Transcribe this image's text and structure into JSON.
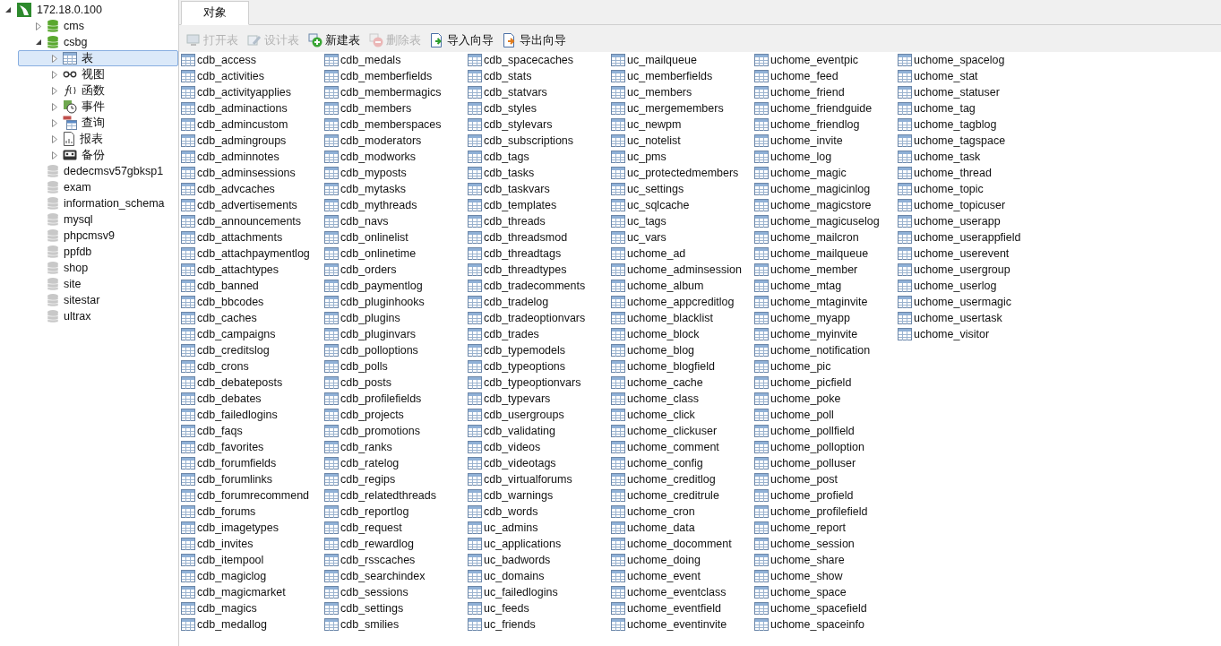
{
  "tree": [
    {
      "kind": "server",
      "label": "172.18.0.100",
      "expanded": true,
      "children": [
        {
          "kind": "database",
          "label": "cms",
          "open": true,
          "expanded": false,
          "selected": false
        },
        {
          "kind": "database",
          "label": "csbg",
          "open": true,
          "expanded": true,
          "selected": false,
          "children": [
            {
              "kind": "tables",
              "label": "表",
              "expanded": false,
              "selected": true
            },
            {
              "kind": "views",
              "label": "视图",
              "expanded": false,
              "selected": false
            },
            {
              "kind": "functions",
              "label": "函数",
              "expanded": false,
              "selected": false
            },
            {
              "kind": "events",
              "label": "事件",
              "expanded": false,
              "selected": false
            },
            {
              "kind": "queries",
              "label": "查询",
              "expanded": false,
              "selected": false
            },
            {
              "kind": "reports",
              "label": "报表",
              "expanded": false,
              "selected": false
            },
            {
              "kind": "backups",
              "label": "备份",
              "expanded": false,
              "selected": false
            }
          ]
        },
        {
          "kind": "database",
          "label": "dedecmsv57gbksp1",
          "open": false,
          "selected": false
        },
        {
          "kind": "database",
          "label": "exam",
          "open": false,
          "selected": false
        },
        {
          "kind": "database",
          "label": "information_schema",
          "open": false,
          "selected": false
        },
        {
          "kind": "database",
          "label": "mysql",
          "open": false,
          "selected": false
        },
        {
          "kind": "database",
          "label": "phpcmsv9",
          "open": false,
          "selected": false
        },
        {
          "kind": "database",
          "label": "ppfdb",
          "open": false,
          "selected": false
        },
        {
          "kind": "database",
          "label": "shop",
          "open": false,
          "selected": false
        },
        {
          "kind": "database",
          "label": "site",
          "open": false,
          "selected": false
        },
        {
          "kind": "database",
          "label": "sitestar",
          "open": false,
          "selected": false
        },
        {
          "kind": "database",
          "label": "ultrax",
          "open": false,
          "selected": false
        }
      ]
    }
  ],
  "tabs": [
    {
      "label": "对象",
      "selected": true
    }
  ],
  "toolbar": [
    {
      "kind": "open",
      "label": "打开表",
      "disabled": true
    },
    {
      "kind": "design",
      "label": "设计表",
      "disabled": true
    },
    {
      "kind": "new",
      "label": "新建表",
      "disabled": false
    },
    {
      "kind": "delete",
      "label": "删除表",
      "disabled": true
    },
    {
      "kind": "import",
      "label": "导入向导",
      "disabled": false
    },
    {
      "kind": "export",
      "label": "导出向导",
      "disabled": false
    }
  ],
  "tables": [
    "cdb_access",
    "cdb_activities",
    "cdb_activityapplies",
    "cdb_adminactions",
    "cdb_admincustom",
    "cdb_admingroups",
    "cdb_adminnotes",
    "cdb_adminsessions",
    "cdb_advcaches",
    "cdb_advertisements",
    "cdb_announcements",
    "cdb_attachments",
    "cdb_attachpaymentlog",
    "cdb_attachtypes",
    "cdb_banned",
    "cdb_bbcodes",
    "cdb_caches",
    "cdb_campaigns",
    "cdb_creditslog",
    "cdb_crons",
    "cdb_debateposts",
    "cdb_debates",
    "cdb_failedlogins",
    "cdb_faqs",
    "cdb_favorites",
    "cdb_forumfields",
    "cdb_forumlinks",
    "cdb_forumrecommend",
    "cdb_forums",
    "cdb_imagetypes",
    "cdb_invites",
    "cdb_itempool",
    "cdb_magiclog",
    "cdb_magicmarket",
    "cdb_magics",
    "cdb_medallog",
    "cdb_medals",
    "cdb_memberfields",
    "cdb_membermagics",
    "cdb_members",
    "cdb_memberspaces",
    "cdb_moderators",
    "cdb_modworks",
    "cdb_myposts",
    "cdb_mytasks",
    "cdb_mythreads",
    "cdb_navs",
    "cdb_onlinelist",
    "cdb_onlinetime",
    "cdb_orders",
    "cdb_paymentlog",
    "cdb_pluginhooks",
    "cdb_plugins",
    "cdb_pluginvars",
    "cdb_polloptions",
    "cdb_polls",
    "cdb_posts",
    "cdb_profilefields",
    "cdb_projects",
    "cdb_promotions",
    "cdb_ranks",
    "cdb_ratelog",
    "cdb_regips",
    "cdb_relatedthreads",
    "cdb_reportlog",
    "cdb_request",
    "cdb_rewardlog",
    "cdb_rsscaches",
    "cdb_searchindex",
    "cdb_sessions",
    "cdb_settings",
    "cdb_smilies",
    "cdb_spacecaches",
    "cdb_stats",
    "cdb_statvars",
    "cdb_styles",
    "cdb_stylevars",
    "cdb_subscriptions",
    "cdb_tags",
    "cdb_tasks",
    "cdb_taskvars",
    "cdb_templates",
    "cdb_threads",
    "cdb_threadsmod",
    "cdb_threadtags",
    "cdb_threadtypes",
    "cdb_tradecomments",
    "cdb_tradelog",
    "cdb_tradeoptionvars",
    "cdb_trades",
    "cdb_typemodels",
    "cdb_typeoptions",
    "cdb_typeoptionvars",
    "cdb_typevars",
    "cdb_usergroups",
    "cdb_validating",
    "cdb_videos",
    "cdb_videotags",
    "cdb_virtualforums",
    "cdb_warnings",
    "cdb_words",
    "uc_admins",
    "uc_applications",
    "uc_badwords",
    "uc_domains",
    "uc_failedlogins",
    "uc_feeds",
    "uc_friends",
    "uc_mailqueue",
    "uc_memberfields",
    "uc_members",
    "uc_mergemembers",
    "uc_newpm",
    "uc_notelist",
    "uc_pms",
    "uc_protectedmembers",
    "uc_settings",
    "uc_sqlcache",
    "uc_tags",
    "uc_vars",
    "uchome_ad",
    "uchome_adminsession",
    "uchome_album",
    "uchome_appcreditlog",
    "uchome_blacklist",
    "uchome_block",
    "uchome_blog",
    "uchome_blogfield",
    "uchome_cache",
    "uchome_class",
    "uchome_click",
    "uchome_clickuser",
    "uchome_comment",
    "uchome_config",
    "uchome_creditlog",
    "uchome_creditrule",
    "uchome_cron",
    "uchome_data",
    "uchome_docomment",
    "uchome_doing",
    "uchome_event",
    "uchome_eventclass",
    "uchome_eventfield",
    "uchome_eventinvite",
    "uchome_eventpic",
    "uchome_feed",
    "uchome_friend",
    "uchome_friendguide",
    "uchome_friendlog",
    "uchome_invite",
    "uchome_log",
    "uchome_magic",
    "uchome_magicinlog",
    "uchome_magicstore",
    "uchome_magicuselog",
    "uchome_mailcron",
    "uchome_mailqueue",
    "uchome_member",
    "uchome_mtag",
    "uchome_mtaginvite",
    "uchome_myapp",
    "uchome_myinvite",
    "uchome_notification",
    "uchome_pic",
    "uchome_picfield",
    "uchome_poke",
    "uchome_poll",
    "uchome_pollfield",
    "uchome_polloption",
    "uchome_polluser",
    "uchome_post",
    "uchome_profield",
    "uchome_profilefield",
    "uchome_report",
    "uchome_session",
    "uchome_share",
    "uchome_show",
    "uchome_space",
    "uchome_spacefield",
    "uchome_spaceinfo",
    "uchome_spacelog",
    "uchome_stat",
    "uchome_statuser",
    "uchome_tag",
    "uchome_tagblog",
    "uchome_tagspace",
    "uchome_task",
    "uchome_thread",
    "uchome_topic",
    "uchome_topicuser",
    "uchome_userapp",
    "uchome_userappfield",
    "uchome_userevent",
    "uchome_usergroup",
    "uchome_userlog",
    "uchome_usermagic",
    "uchome_usertask",
    "uchome_visitor"
  ]
}
